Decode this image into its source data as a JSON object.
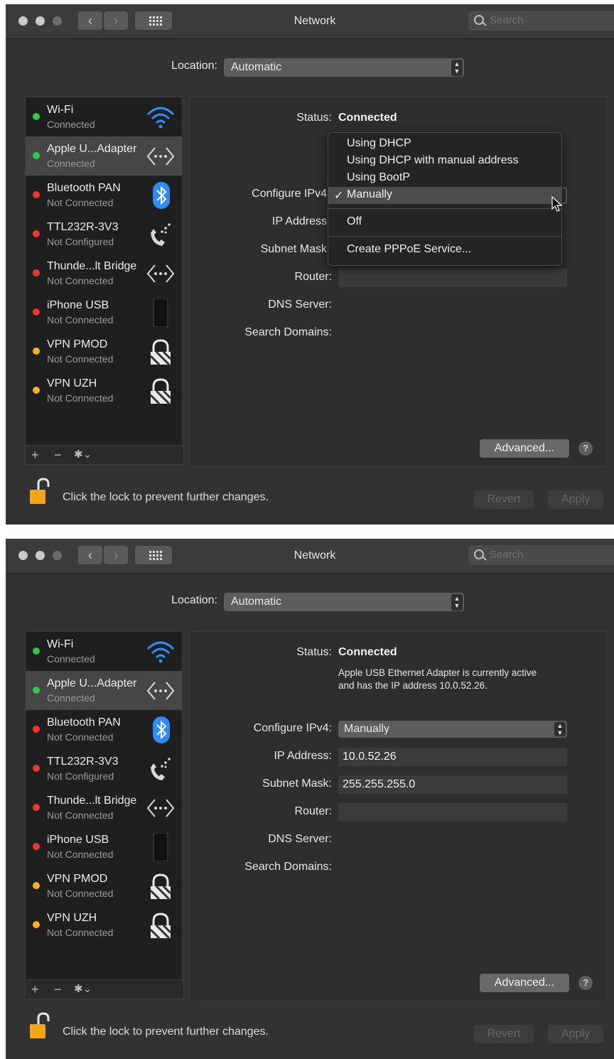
{
  "window": {
    "title": "Network",
    "search_placeholder": "Search",
    "location_label": "Location:",
    "location_value": "Automatic"
  },
  "services": [
    {
      "name": "Wi-Fi",
      "status": "Connected",
      "status_color": "#30c94e",
      "icon": "wifi-icon"
    },
    {
      "name": "Apple U...Adapter",
      "status": "Connected",
      "status_color": "#30c94e",
      "icon": "ethernet-icon"
    },
    {
      "name": "Bluetooth PAN",
      "status": "Not Connected",
      "status_color": "#e8382f",
      "icon": "bluetooth-icon"
    },
    {
      "name": "TTL232R-3V3",
      "status": "Not Configured",
      "status_color": "#e8382f",
      "icon": "phone-modem-icon"
    },
    {
      "name": "Thunde...lt Bridge",
      "status": "Not Connected",
      "status_color": "#e8382f",
      "icon": "ethernet-icon"
    },
    {
      "name": "iPhone USB",
      "status": "Not Connected",
      "status_color": "#e8382f",
      "icon": "iphone-icon"
    },
    {
      "name": "VPN PMOD",
      "status": "Not Connected",
      "status_color": "#f2b31d",
      "icon": "vpn-lock-icon"
    },
    {
      "name": "VPN UZH",
      "status": "Not Connected",
      "status_color": "#f2b31d",
      "icon": "vpn-lock-icon"
    }
  ],
  "sidebar_buttons": {
    "add": "+",
    "remove": "−",
    "action": "✱⌄"
  },
  "detail": {
    "status_label": "Status:",
    "status_value": "Connected",
    "status_desc_line1": "Apple USB Ethernet Adapter is currently active",
    "status_desc_line2": "and has the IP address 10.0.52.26.",
    "configure_label": "Configure IPv4:",
    "configure_label_cut": "Configure IPv4",
    "configure_value": "Manually",
    "ip_label": "IP Address:",
    "ip_label_cut": "IP Address",
    "ip_value": "10.0.52.26",
    "subnet_label": "Subnet Mask:",
    "subnet_label_cut": "Subnet Mask",
    "subnet_value": "255.255.255.0",
    "router_label": "Router:",
    "dns_label": "DNS Server:",
    "search_domains_label": "Search Domains:",
    "advanced_button": "Advanced...",
    "help_button": "?"
  },
  "configure_menu": {
    "items": [
      "Using DHCP",
      "Using DHCP with manual address",
      "Using BootP",
      "Manually",
      "Off",
      "Create PPPoE Service..."
    ],
    "selected": "Manually",
    "check": "✓"
  },
  "footer": {
    "lock_message": "Click the lock to prevent further changes.",
    "revert_button": "Revert",
    "apply_button": "Apply"
  }
}
